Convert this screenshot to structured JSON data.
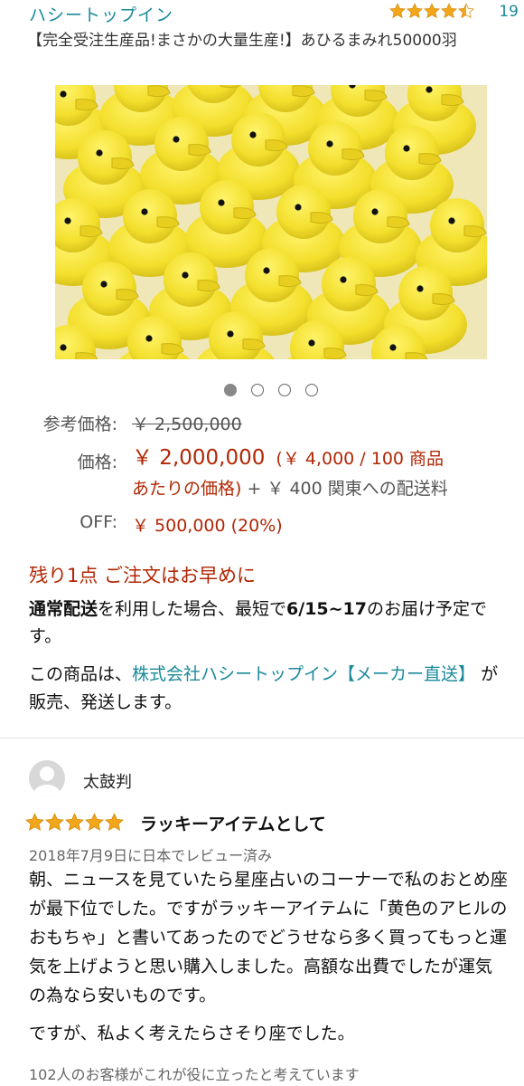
{
  "header": {
    "brand": "ハシートップイン",
    "rating_count": "19",
    "rating_value": 4.5
  },
  "product": {
    "title": "【完全受注生産品!まさかの大量生産!】あひるまみれ50000羽"
  },
  "carousel": {
    "count": 4,
    "active": 0
  },
  "pricing": {
    "list_label": "参考価格:",
    "list_value": "￥ 2,500,000",
    "price_label": "価格:",
    "price_value": "￥ 2,000,000",
    "unit_price_a": "(￥ 4,000 / 100 商品",
    "unit_price_b": "あたりの価格)",
    "shipping": " + ￥ 400 関東への配送料",
    "off_label": "OFF:",
    "off_value": "￥ 500,000 (20%)"
  },
  "availability": {
    "stock": "残り1点 ご注文はお早めに",
    "delivery_bold_1": "通常配送",
    "delivery_text_1": "を利用した場合、最短で",
    "delivery_bold_2": "6/15~17",
    "delivery_text_2": "のお届け予定です。",
    "seller_prefix": "この商品は、",
    "seller_link": "株式会社ハシートップイン【メーカー直送】",
    "seller_suffix": " が販売、発送します。"
  },
  "review": {
    "reviewer": "太鼓判",
    "rating": 5,
    "title": "ラッキーアイテムとして",
    "date": "2018年7月9日に日本でレビュー済み",
    "body": "朝、ニュースを見ていたら星座占いのコーナーで私のおとめ座が最下位でした。ですがラッキーアイテムに「黄色のアヒルのおもちゃ」と書いてあったのでどうせなら多く買ってもっと運気を上げようと思い購入しました。高額な出費でしたが運気の為なら安いものです。",
    "body2": "ですが、私よく考えたらさそり座でした。",
    "helpful": "102人のお客様がこれが役に立ったと考えています"
  },
  "colors": {
    "link": "#1a8a9a",
    "price": "#b12704",
    "star": "#f2a71b"
  }
}
